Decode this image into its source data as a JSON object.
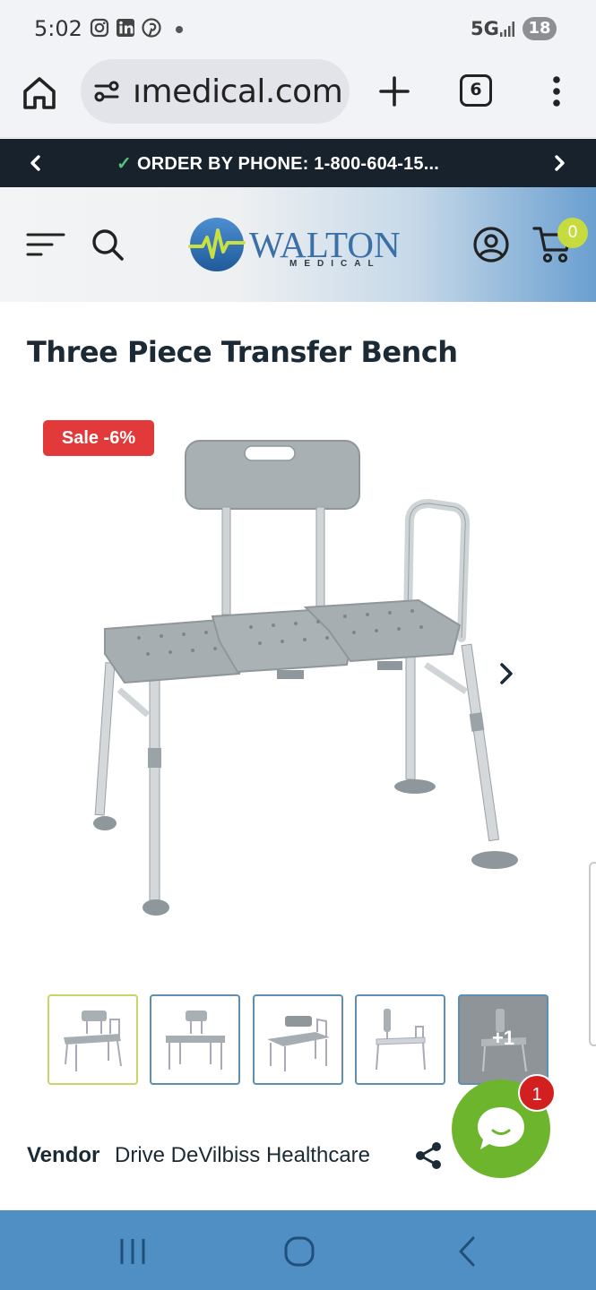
{
  "status_bar": {
    "time": "5:02",
    "network": "5G",
    "battery": "18",
    "notification_icons": [
      "instagram-icon",
      "linkedin-icon",
      "pinterest-icon"
    ]
  },
  "browser": {
    "url_text": "ımedical.com",
    "tab_count": "6"
  },
  "announcement": {
    "text": "ORDER BY PHONE: 1-800-604-15...",
    "check": "✓"
  },
  "header": {
    "logo_word": "WALTON",
    "logo_sub": "MEDICAL",
    "cart_count": "0"
  },
  "product": {
    "title": "Three Piece Transfer Bench",
    "sale_badge": "Sale -6%",
    "thumbnail_more": "+1",
    "vendor_label": "Vendor",
    "vendor_value": "Drive DeVilbiss Healthcare"
  },
  "chat": {
    "unread": "1"
  },
  "colors": {
    "announce_bg": "#17222c",
    "sale_red": "#e23a3a",
    "chat_green": "#6db52d",
    "cart_badge": "#c5db3f",
    "nav_blue": "#4f8fc3"
  }
}
